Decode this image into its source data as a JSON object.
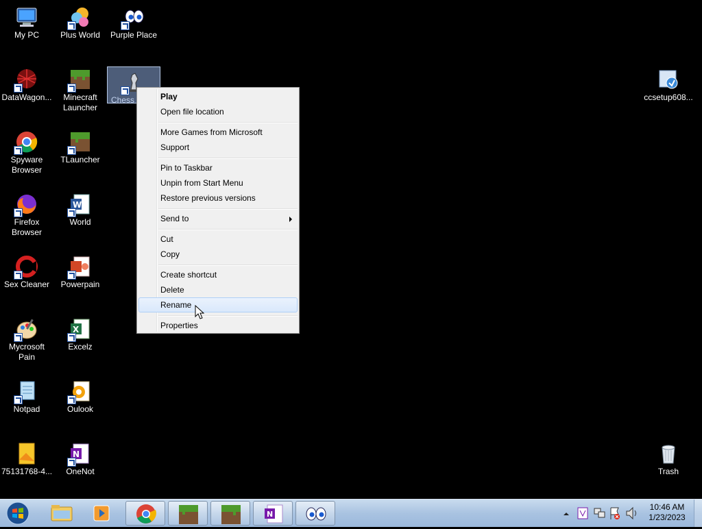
{
  "desktop": {
    "icons": {
      "mypc": "My PC",
      "plusworld": "Plus World",
      "purpleplace": "Purple Place",
      "datawagon": "DataWagon...",
      "minecraft": "Minecraft Launcher",
      "chess": "Chess T",
      "ccsetup": "ccsetup608...",
      "spyware": "Spyware Browser",
      "tlauncher": "TLauncher",
      "firefox": "Firefox Browser",
      "world": "World",
      "sexcleaner": "Sex Cleaner",
      "powerpain": "Powerpain",
      "mycrosoft": "Mycrosoft Pain",
      "excelz": "Excelz",
      "notpad": "Notpad",
      "oulook": "Oulook",
      "file7513": "75131768-4...",
      "onenot": "OneNot",
      "trash": "Trash"
    }
  },
  "context_menu": {
    "play": "Play",
    "open_location": "Open file location",
    "more_games": "More Games from Microsoft",
    "support": "Support",
    "pin_taskbar": "Pin to Taskbar",
    "unpin_start": "Unpin from Start Menu",
    "restore": "Restore previous versions",
    "send_to": "Send to",
    "cut": "Cut",
    "copy": "Copy",
    "create_shortcut": "Create shortcut",
    "delete": "Delete",
    "rename": "Rename",
    "properties": "Properties"
  },
  "taskbar": {
    "clock_time": "10:46 AM",
    "clock_date": "1/23/2023"
  },
  "colors": {
    "menu_bg": "#f0f0f0",
    "menu_hover": "#d9e8fb",
    "taskbar": "#a9c3e1",
    "desktop": "#000000"
  }
}
